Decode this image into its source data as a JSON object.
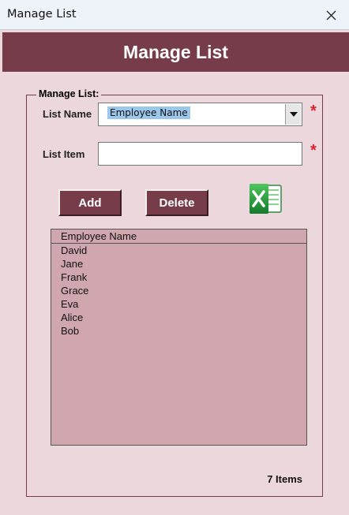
{
  "window": {
    "title": "Manage List",
    "close_icon": "close-icon"
  },
  "header": {
    "title": "Manage List"
  },
  "group": {
    "legend": "Manage List:"
  },
  "form": {
    "list_name_label": "List Name",
    "list_name_value": "Employee Name",
    "list_item_label": "List Item",
    "list_item_value": "",
    "required_marker": "*",
    "required_color": "#e0202a"
  },
  "buttons": {
    "add": "Add",
    "delete": "Delete",
    "excel_icon": "excel-icon"
  },
  "list": {
    "header": "Employee Name",
    "items": [
      "David",
      "Jane",
      "Frank",
      "Grace",
      "Eva",
      "Alice",
      "Bob"
    ]
  },
  "footer": {
    "count": "7 Items"
  },
  "colors": {
    "accent": "#773c49",
    "background": "#ecd8dc",
    "list_bg": "#d0a7af"
  }
}
